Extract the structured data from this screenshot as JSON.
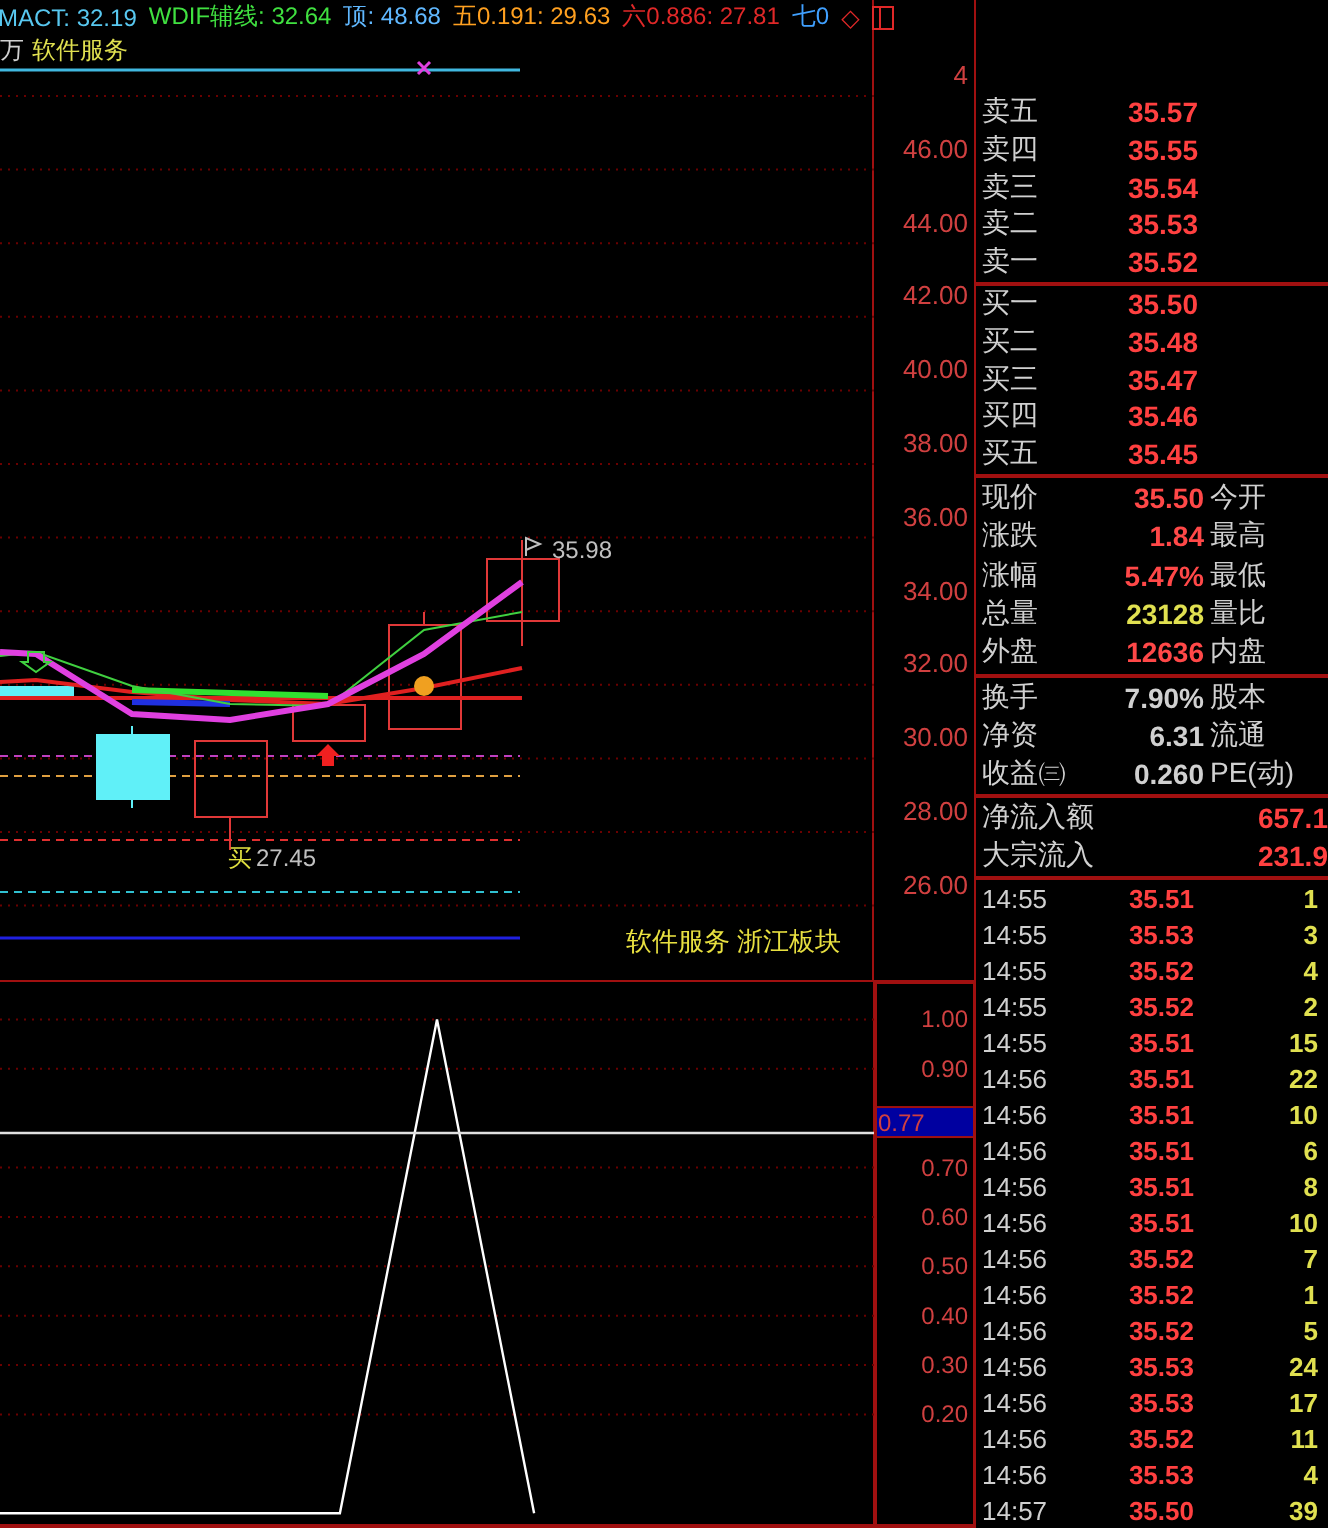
{
  "legend": [
    {
      "text": "MACT: 32.19",
      "color": "#58c8f0"
    },
    {
      "text": "WDIF辅线: 32.64",
      "color": "#40e040"
    },
    {
      "text": "顶: 48.68",
      "color": "#60b8ff"
    },
    {
      "text": "五0.191: 29.63",
      "color": "#ffa020"
    },
    {
      "text": "六0.886: 27.81",
      "color": "#e02828"
    },
    {
      "text": "七0",
      "color": "#40a0ff"
    },
    {
      "text": "◇",
      "color": "#e02828"
    }
  ],
  "sector_line": {
    "prefix": "万",
    "name": "软件服务"
  },
  "price_chart": {
    "axis_labels": [
      "4",
      "46.00",
      "44.00",
      "42.00",
      "40.00",
      "38.00",
      "36.00",
      "34.00",
      "32.00",
      "30.00",
      "28.00",
      "26.00"
    ],
    "high_label": "35.98",
    "low_marker": "买",
    "low_label": "27.45",
    "sector_tags": "软件服务 浙江板块"
  },
  "indicator": {
    "current_value": "0.77",
    "chart_data": {
      "type": "line",
      "series": [
        {
          "color": "#ffffff",
          "values": [
            0,
            0,
            0,
            0,
            0,
            0,
            0,
            0,
            0.5,
            1,
            0.5,
            0,
            null,
            null,
            null,
            null,
            null,
            null,
            null
          ]
        },
        {
          "color": "#e0e0e0",
          "values": [
            0.77,
            0.77,
            0.77,
            0.77,
            0.77,
            0.77,
            0.77,
            0.77,
            0.77,
            0.77,
            0.77,
            0.77,
            0.77,
            0.77,
            0.77,
            0.77,
            0.77,
            0.77,
            0.77
          ]
        }
      ],
      "ylim": [
        -0.03,
        1.08
      ],
      "grid": true,
      "yticks": [
        {
          "value": 1.0,
          "label": "1.00"
        },
        {
          "value": 0.9,
          "label": "0.90"
        },
        {
          "value": 0.7,
          "label": "0.70"
        },
        {
          "value": 0.6,
          "label": "0.60"
        },
        {
          "value": 0.5,
          "label": "0.50"
        },
        {
          "value": 0.4,
          "label": "0.40"
        },
        {
          "value": 0.3,
          "label": "0.30"
        },
        {
          "value": 0.2,
          "label": "0.20"
        }
      ]
    }
  },
  "order_book": {
    "asks": [
      {
        "label": "卖五",
        "price": "35.57"
      },
      {
        "label": "卖四",
        "price": "35.55"
      },
      {
        "label": "卖三",
        "price": "35.54"
      },
      {
        "label": "卖二",
        "price": "35.53"
      },
      {
        "label": "卖一",
        "price": "35.52"
      }
    ],
    "bids": [
      {
        "label": "买一",
        "price": "35.50"
      },
      {
        "label": "买二",
        "price": "35.48"
      },
      {
        "label": "买三",
        "price": "35.47"
      },
      {
        "label": "买四",
        "price": "35.46"
      },
      {
        "label": "买五",
        "price": "35.45"
      }
    ]
  },
  "quote": [
    {
      "label": "现价",
      "value": "35.50",
      "label_2": "今开",
      "color": "#ff4848"
    },
    {
      "label": "涨跌",
      "value": "1.84",
      "label_2": "最高",
      "color": "#ff4848"
    },
    {
      "label": "涨幅",
      "value": "5.47%",
      "label_2": "最低",
      "color": "#ff4848"
    },
    {
      "label": "总量",
      "value": "23128",
      "label_2": "量比",
      "color": "#e0e050"
    },
    {
      "label": "外盘",
      "value": "12636",
      "label_2": "内盘",
      "color": "#ff4848"
    }
  ],
  "fundamentals": [
    {
      "label": "换手",
      "value": "7.90%",
      "label_2": "股本"
    },
    {
      "label": "净资",
      "value": "6.31",
      "label_2": "流通"
    },
    {
      "label": "收益㈢",
      "value": "0.260",
      "label_2": "PE(动)"
    }
  ],
  "flows": [
    {
      "label": "净流入额",
      "value": "657.1"
    },
    {
      "label": "大宗流入",
      "value": "231.9"
    }
  ],
  "ticks": [
    {
      "time": "14:55",
      "price": "35.51",
      "volume": "1"
    },
    {
      "time": "14:55",
      "price": "35.53",
      "volume": "3"
    },
    {
      "time": "14:55",
      "price": "35.52",
      "volume": "4"
    },
    {
      "time": "14:55",
      "price": "35.52",
      "volume": "2"
    },
    {
      "time": "14:55",
      "price": "35.51",
      "volume": "15"
    },
    {
      "time": "14:56",
      "price": "35.51",
      "volume": "22"
    },
    {
      "time": "14:56",
      "price": "35.51",
      "volume": "10"
    },
    {
      "time": "14:56",
      "price": "35.51",
      "volume": "6"
    },
    {
      "time": "14:56",
      "price": "35.51",
      "volume": "8"
    },
    {
      "time": "14:56",
      "price": "35.51",
      "volume": "10"
    },
    {
      "time": "14:56",
      "price": "35.52",
      "volume": "7"
    },
    {
      "time": "14:56",
      "price": "35.52",
      "volume": "1"
    },
    {
      "time": "14:56",
      "price": "35.52",
      "volume": "5"
    },
    {
      "time": "14:56",
      "price": "35.53",
      "volume": "24"
    },
    {
      "time": "14:56",
      "price": "35.53",
      "volume": "17"
    },
    {
      "time": "14:56",
      "price": "35.52",
      "volume": "11"
    },
    {
      "time": "14:56",
      "price": "35.53",
      "volume": "4"
    },
    {
      "time": "14:57",
      "price": "35.50",
      "volume": "39"
    }
  ]
}
